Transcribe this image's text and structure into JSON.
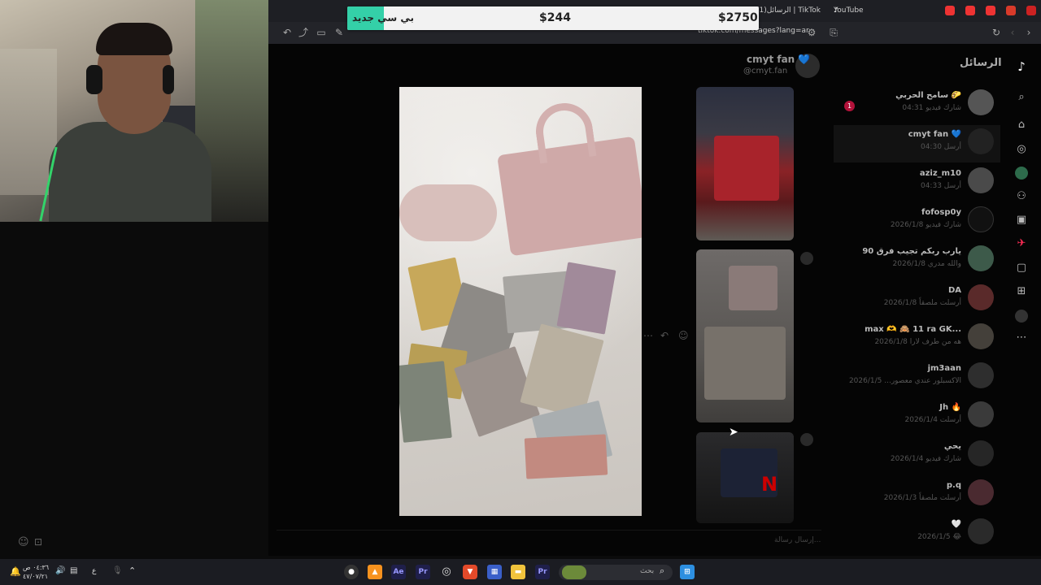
{
  "banner": {
    "label": "بي سي جديد",
    "price_mid": "$244",
    "price_right": "$2750"
  },
  "browser": {
    "tab_active": "(1)الرسائل | TikTok",
    "tab_youtube": "YouTube",
    "url": "tiktok.com/messages?lang=ar"
  },
  "sidebar": {
    "title": "الرسائل",
    "unread_count": "1",
    "conversations": [
      {
        "name": "سامح الحربي 🌮",
        "sub": "شارك فيديو 04:31"
      },
      {
        "name": "cmyt fan 💙",
        "sub": "أرسل 04:30"
      },
      {
        "name": "aziz_m10",
        "sub": "أرسل 04:33"
      },
      {
        "name": "fofosp0y",
        "sub": "شارك فيديو 2026/1/8"
      },
      {
        "name": "يارب ربكم تجيب فرق 90",
        "sub": "والله مدري 2026/1/8"
      },
      {
        "name": "DA",
        "sub": "أرسلت ملصقاً 2026/1/8"
      },
      {
        "name": "max 🫶 🙈 11 ra GK...",
        "sub": "هه من طرف لارا 2026/1/8"
      },
      {
        "name": "jm3aan",
        "sub": "الاكسبلور عندي معصور... 2026/1/5"
      },
      {
        "name": "Jh 🔥",
        "sub": "أرسلت 2026/1/4"
      },
      {
        "name": "يحي",
        "sub": "شارك فيديو 2026/1/4"
      },
      {
        "name": "p.q",
        "sub": "أرسلت ملصقاً 2026/1/3"
      },
      {
        "name": "🤍",
        "sub": "2026/1/5 😂"
      }
    ]
  },
  "chat": {
    "name": "cmyt fan 💙",
    "handle": "@cmyt.fan",
    "input_placeholder": "إرسال رسالة..."
  },
  "taskbar": {
    "time": "٠٤:٣٦ ص",
    "date": "٤٧/٠٧/٢١",
    "lang": "ع",
    "search_placeholder": "بحث"
  },
  "colors": {
    "tiktok_red": "#fe2c55",
    "accent_green": "#34d0a8",
    "banner_bg": "#f2f2f2"
  }
}
